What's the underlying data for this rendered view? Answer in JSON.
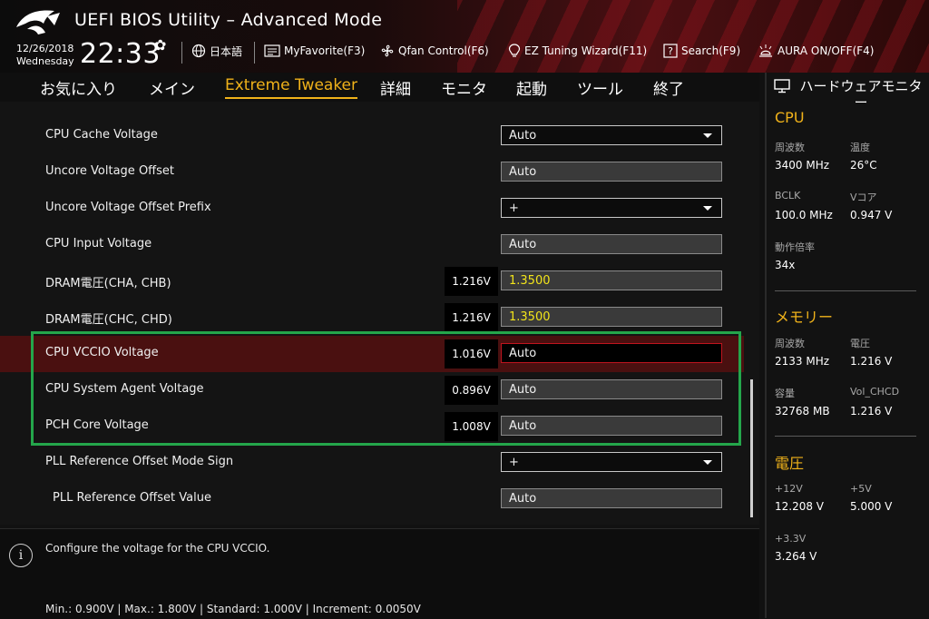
{
  "header": {
    "title": "UEFI BIOS Utility – Advanced Mode",
    "date": "12/26/2018",
    "weekday": "Wednesday",
    "time": "22:33",
    "toolbar": {
      "language": "日本語",
      "myfavorite": "MyFavorite(F3)",
      "qfan": "Qfan Control(F6)",
      "ez_tuning": "EZ Tuning Wizard(F11)",
      "search": "Search(F9)",
      "aura": "AURA ON/OFF(F4)"
    }
  },
  "nav": {
    "tabs": [
      "お気に入り",
      "メイン",
      "Extreme Tweaker",
      "詳細",
      "モニタ",
      "起動",
      "ツール",
      "終了"
    ],
    "active_tab": "Extreme Tweaker"
  },
  "settings": [
    {
      "label": "CPU Cache Voltage",
      "value": "Auto",
      "type": "select"
    },
    {
      "label": "Uncore Voltage Offset",
      "value": "Auto",
      "type": "input"
    },
    {
      "label": "Uncore Voltage Offset Prefix",
      "value": "+",
      "type": "select"
    },
    {
      "label": "CPU Input Voltage",
      "value": "Auto",
      "type": "input"
    },
    {
      "label": "DRAM電圧(CHA, CHB)",
      "current_voltage": "1.216V",
      "value": "1.3500",
      "type": "input"
    },
    {
      "label": "DRAM電圧(CHC, CHD)",
      "current_voltage": "1.216V",
      "value": "1.3500",
      "type": "input"
    },
    {
      "label": "CPU VCCIO Voltage",
      "current_voltage": "1.016V",
      "value": "Auto",
      "type": "input",
      "selected": true
    },
    {
      "label": "CPU System Agent Voltage",
      "current_voltage": "0.896V",
      "value": "Auto",
      "type": "input"
    },
    {
      "label": "PCH Core Voltage",
      "current_voltage": "1.008V",
      "value": "Auto",
      "type": "input"
    },
    {
      "label": "PLL Reference Offset Mode Sign",
      "value": "+",
      "type": "select"
    },
    {
      "label": "PLL Reference Offset Value",
      "value": "Auto",
      "type": "input"
    }
  ],
  "help": {
    "description": "Configure the voltage for the CPU VCCIO.",
    "specs": "Min.: 0.900V   |   Max.: 1.800V   |   Standard: 1.000V   |   Increment: 0.0050V"
  },
  "monitor": {
    "title": "ハードウェアモニター",
    "cpu": {
      "title": "CPU",
      "freq_label": "周波数",
      "freq_value": "3400 MHz",
      "temp_label": "温度",
      "temp_value": "26°C",
      "bclk_label": "BCLK",
      "bclk_value": "100.0 MHz",
      "vcore_label": "Vコア",
      "vcore_value": "0.947 V",
      "ratio_label": "動作倍率",
      "ratio_value": "34x"
    },
    "memory": {
      "title": "メモリー",
      "freq_label": "周波数",
      "freq_value": "2133 MHz",
      "volt_label": "電圧",
      "volt_value": "1.216 V",
      "cap_label": "容量",
      "cap_value": "32768 MB",
      "volchcd_label": "Vol_CHCD",
      "volchcd_value": "1.216 V"
    },
    "voltage": {
      "title": "電圧",
      "v12_label": "+12V",
      "v12_value": "12.208 V",
      "v5_label": "+5V",
      "v5_value": "5.000 V",
      "v33_label": "+3.3V",
      "v33_value": "3.264 V"
    }
  },
  "colors": {
    "accent": "#f0b21a",
    "selected_row": "#4a1010",
    "highlight_border": "#24a64b",
    "edit_border": "#c0141e",
    "dram_value": "#f2e41a"
  }
}
